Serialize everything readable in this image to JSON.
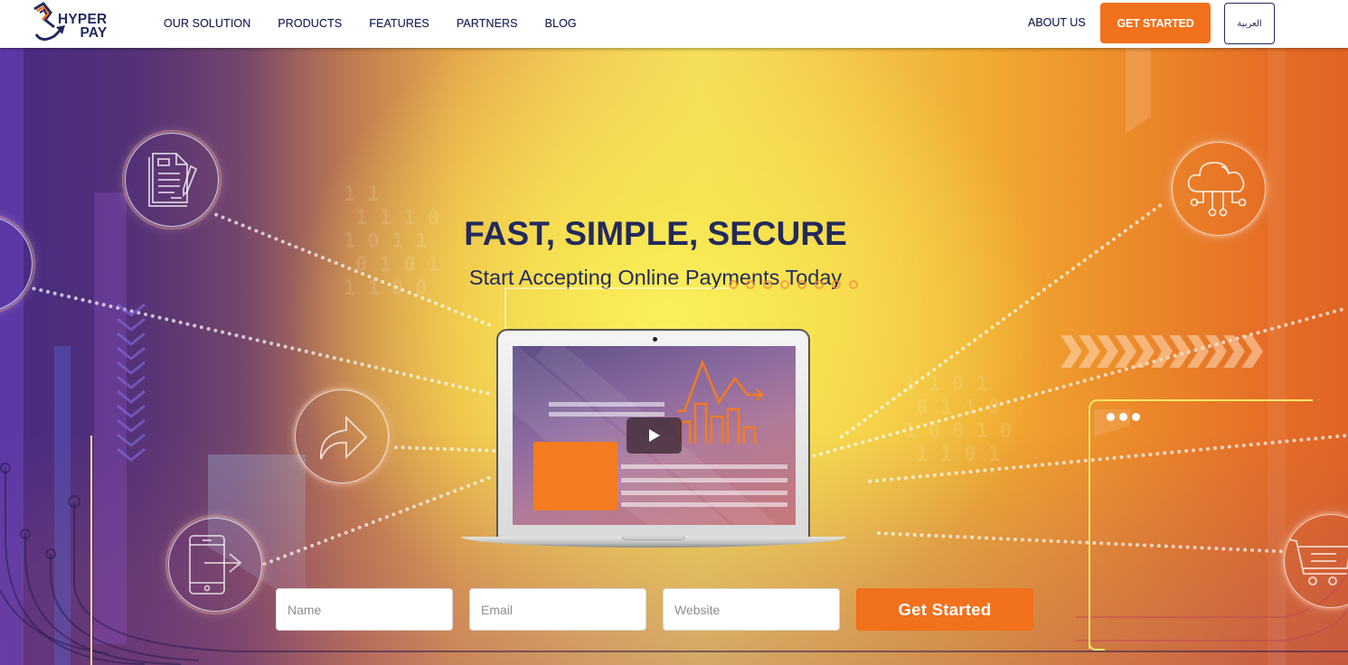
{
  "brand": {
    "name_line1": "HYPER",
    "name_line2": "PAY",
    "colors": {
      "navy": "#232a5c",
      "orange": "#f2711c"
    }
  },
  "nav": {
    "links": [
      {
        "label": "OUR SOLUTION"
      },
      {
        "label": "PRODUCTS"
      },
      {
        "label": "FEATURES"
      },
      {
        "label": "PARTNERS"
      },
      {
        "label": "BLOG"
      }
    ],
    "about_label": "ABOUT US",
    "cta_label": "GET STARTED",
    "language_label": "العربية"
  },
  "hero": {
    "headline": "FAST, SIMPLE, SECURE",
    "subheadline": "Start Accepting Online Payments Today",
    "icons": [
      "document-pen-icon",
      "share-arrow-icon",
      "mobile-transfer-icon",
      "cloud-network-icon",
      "shopping-cart-icon"
    ],
    "video": {
      "play_icon": "play-icon"
    }
  },
  "form": {
    "name_placeholder": "Name",
    "email_placeholder": "Email",
    "website_placeholder": "Website",
    "name_value": "",
    "email_value": "",
    "website_value": "",
    "submit_label": "Get Started"
  }
}
